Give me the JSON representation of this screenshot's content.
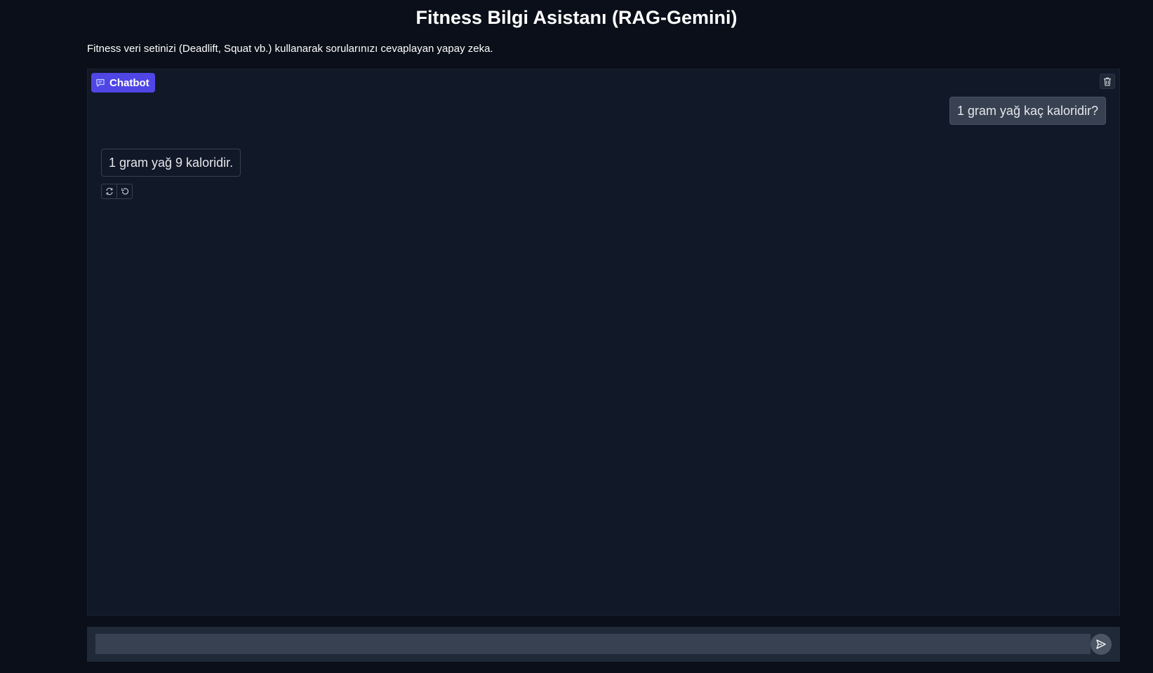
{
  "header": {
    "title": "Fitness Bilgi Asistanı (RAG-Gemini)",
    "description": "Fitness veri setinizi (Deadlift, Squat vb.) kullanarak sorularınızı cevaplayan yapay zeka."
  },
  "chatbot": {
    "label": "Chatbot",
    "label_icon": "chat-bubble-icon",
    "clear_icon": "trash-icon",
    "messages": [
      {
        "role": "user",
        "text": "1 gram yağ kaç kaloridir?"
      },
      {
        "role": "bot",
        "text": "1 gram yağ 9 kaloridir."
      }
    ],
    "message_actions": [
      "retry-icon",
      "undo-icon"
    ]
  },
  "input": {
    "value": "",
    "placeholder": "",
    "send_icon": "send-icon"
  },
  "colors": {
    "background": "#0b0f19",
    "panel": "#111827",
    "accent": "#4f46e5",
    "user_bubble": "#374151",
    "input_bg": "#374151"
  }
}
